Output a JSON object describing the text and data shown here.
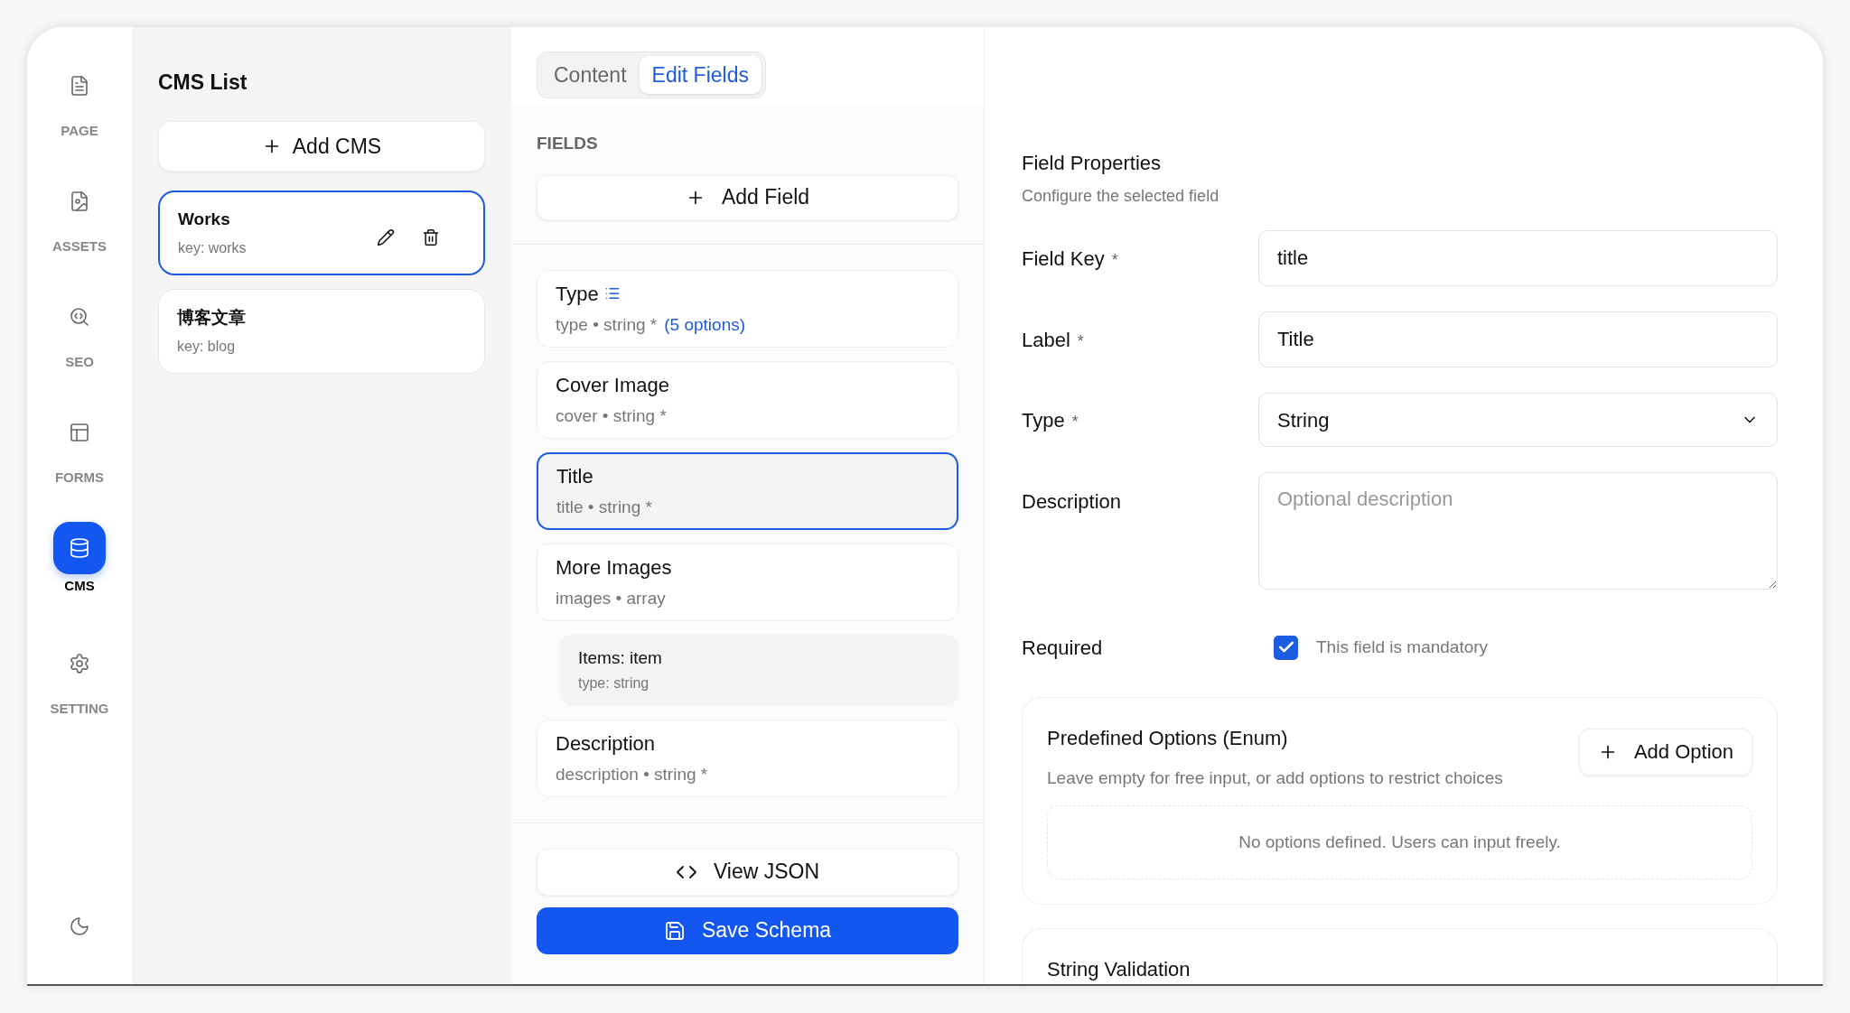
{
  "nav": {
    "items": [
      {
        "label": "PAGE",
        "selected": false
      },
      {
        "label": "ASSETS",
        "selected": false
      },
      {
        "label": "SEO",
        "selected": false
      },
      {
        "label": "FORMS",
        "selected": false
      },
      {
        "label": "CMS",
        "selected": true
      },
      {
        "label": "SETTING",
        "selected": false
      }
    ]
  },
  "cms_list": {
    "title": "CMS List",
    "add_button": "Add CMS",
    "items": [
      {
        "name": "Works",
        "key": "key: works",
        "selected": true
      },
      {
        "name": "博客文章",
        "key": "key: blog",
        "selected": false
      }
    ]
  },
  "editor": {
    "tabs": [
      {
        "label": "Content",
        "selected": false
      },
      {
        "label": "Edit Fields",
        "selected": true
      }
    ],
    "fields_heading": "FIELDS",
    "add_field_button": "Add Field",
    "fields": [
      {
        "label": "Type",
        "meta": "type • string *",
        "options": "(5 options)",
        "selected": false
      },
      {
        "label": "Cover Image",
        "meta": "cover • string *",
        "selected": false
      },
      {
        "label": "Title",
        "meta": "title • string *",
        "selected": true
      },
      {
        "label": "More Images",
        "meta": "images • array",
        "selected": false,
        "children": [
          {
            "label": "Items: item",
            "meta": "type: string"
          }
        ]
      },
      {
        "label": "Description",
        "meta": "description • string *",
        "selected": false
      }
    ],
    "view_json_button": "View JSON",
    "save_button": "Save Schema"
  },
  "properties": {
    "title": "Field Properties",
    "subtitle": "Configure the selected field",
    "rows": [
      {
        "kind": "input",
        "label": "Field Key",
        "mark": "*",
        "value": "title"
      },
      {
        "kind": "input",
        "label": "Label",
        "mark": "*",
        "value": "Title"
      },
      {
        "kind": "select",
        "label": "Type",
        "mark": "*",
        "value": "String"
      },
      {
        "kind": "textarea",
        "label": "Description",
        "placeholder": "Optional description"
      },
      {
        "kind": "checkbox",
        "label": "Required",
        "checked": true,
        "text": "This field is mandatory"
      }
    ],
    "enum": {
      "title": "Predefined Options (Enum)",
      "subtitle": "Leave empty for free input, or add options to restrict choices",
      "add_button": "Add Option",
      "empty_text": "No options defined. Users can input freely."
    },
    "validation": {
      "title": "String Validation"
    }
  }
}
